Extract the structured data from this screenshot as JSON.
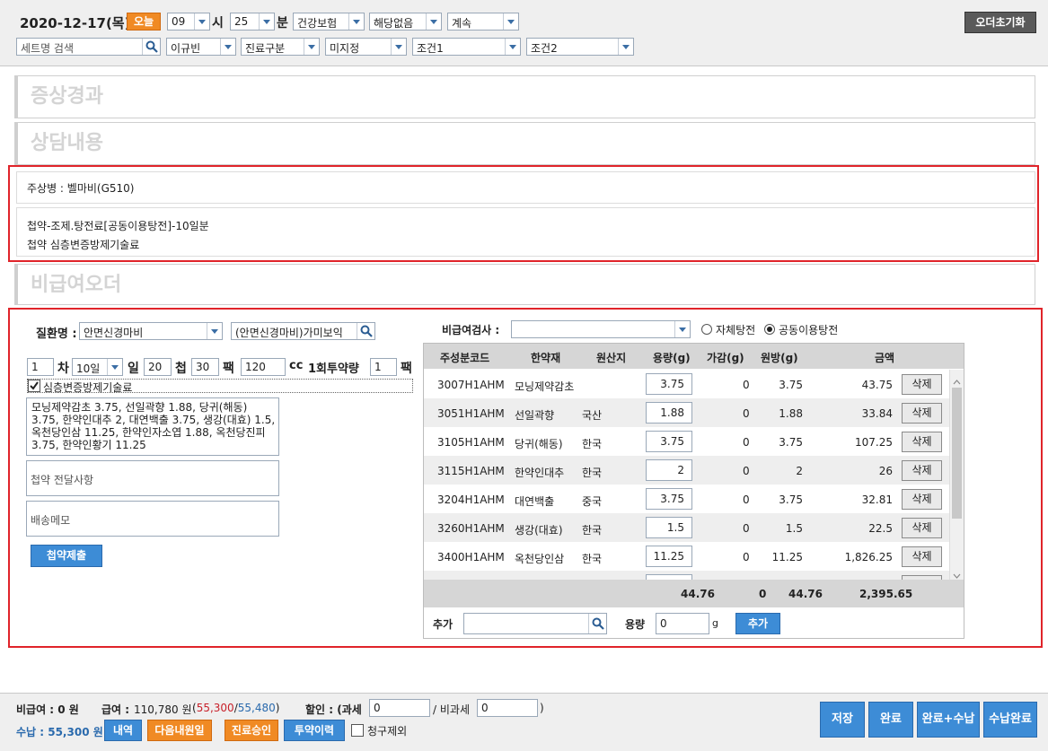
{
  "header": {
    "date": "2020-12-17(목)",
    "today_btn": "오늘",
    "hour": "09",
    "hour_unit": "시",
    "minute": "25",
    "minute_unit": "분",
    "insurance": "건강보험",
    "applicable": "해당없음",
    "continuation": "계속",
    "reset_btn": "오더초기화",
    "set_search_placeholder": "세트명 검색",
    "dept": "이규빈",
    "visit_type": "진료구분",
    "unassigned": "미지정",
    "cond1": "조건1",
    "cond2": "조건2"
  },
  "sections": {
    "symptom_title": "증상경과",
    "consult_title": "상담내용",
    "noncovered_title": "비급여오더"
  },
  "diagnosis": {
    "main_disease": "주상병 : 벨마비(G510)",
    "line1": "첩약-조제.탕전료[공동이용탕전]-10일분",
    "line2": "첩약 심층변증방제기술료"
  },
  "form": {
    "disease_label": "질환명 :",
    "disease_value": "안면신경마비",
    "prescription_value": "(안면신경마비)가미보익",
    "count_value": "1",
    "count_unit": "차",
    "days_value": "10일",
    "days_unit": "일",
    "cheop_value": "20",
    "cheop_unit": "첩",
    "pack_value": "30",
    "pack_unit": "팩",
    "cc_value": "120",
    "cc_unit": "cc",
    "dose_label": "1회투약량",
    "dose_value": "1",
    "dose_unit": "팩",
    "checkbox_label": "심층변증방제기술료",
    "herb_summary": "모닝제약감초 3.75, 선일곽향 1.88, 당귀(해동) 3.75, 한약인대추 2, 대연백출 3.75, 생강(대효) 1.5, 옥천당인삼 11.25, 한약인자소엽 1.88, 옥천당진피 3.75, 한약인황기 11.25",
    "delivery_note_placeholder": "첩약 전달사항",
    "shipping_memo_placeholder": "배송메모",
    "submit_btn": "첩약제출"
  },
  "right": {
    "test_label": "비급여검사 :",
    "radio_self": "자체탕전",
    "radio_shared": "공동이용탕전",
    "table_headers": [
      "주성분코드",
      "한약재",
      "원산지",
      "용량(g)",
      "가감(g)",
      "원방(g)",
      "금액"
    ],
    "rows": [
      {
        "code": "3007H1AHM",
        "name": "모닝제약감초",
        "origin": "",
        "qty": "3.75",
        "adj": "0",
        "orig": "3.75",
        "amount": "43.75",
        "del": "삭제"
      },
      {
        "code": "3051H1AHM",
        "name": "선일곽향",
        "origin": "국산",
        "qty": "1.88",
        "adj": "0",
        "orig": "1.88",
        "amount": "33.84",
        "del": "삭제"
      },
      {
        "code": "3105H1AHM",
        "name": "당귀(해동)",
        "origin": "한국",
        "qty": "3.75",
        "adj": "0",
        "orig": "3.75",
        "amount": "107.25",
        "del": "삭제"
      },
      {
        "code": "3115H1AHM",
        "name": "한약인대추",
        "origin": "한국",
        "qty": "2",
        "adj": "0",
        "orig": "2",
        "amount": "26",
        "del": "삭제"
      },
      {
        "code": "3204H1AHM",
        "name": "대연백출",
        "origin": "중국",
        "qty": "3.75",
        "adj": "0",
        "orig": "3.75",
        "amount": "32.81",
        "del": "삭제"
      },
      {
        "code": "3260H1AHM",
        "name": "생강(대효)",
        "origin": "한국",
        "qty": "1.5",
        "adj": "0",
        "orig": "1.5",
        "amount": "22.5",
        "del": "삭제"
      },
      {
        "code": "3400H1AHM",
        "name": "옥천당인삼",
        "origin": "한국",
        "qty": "11.25",
        "adj": "0",
        "orig": "11.25",
        "amount": "1,826.25",
        "del": "삭제"
      }
    ],
    "totals": {
      "qty": "44.76",
      "adj": "0",
      "orig": "44.76",
      "amount": "2,395.65"
    },
    "add_label": "추가",
    "qty_label": "용량",
    "add_qty_value": "0",
    "add_unit": "g",
    "add_btn": "추가"
  },
  "footer": {
    "noncovered": "비급여 : 0 원",
    "covered_label": "급여 :",
    "covered_value": "110,780 원",
    "covered_split_a": "55,300",
    "covered_split_sep": "/",
    "covered_split_b": "55,480",
    "discount_label": "할인 : (과세",
    "discount_taxed": "0",
    "discount_sep": "/ 비과세",
    "discount_untaxed": "0",
    "discount_close": ")",
    "received": "수납 : 55,300 원",
    "btn_details": "내역",
    "btn_next_visit": "다음내원일",
    "btn_approval": "진료승인",
    "btn_history": "투약이력",
    "claim_exclude": "청구제외",
    "btn_save": "저장",
    "btn_complete": "완료",
    "btn_complete_pay": "완료+수납",
    "btn_pay_complete": "수납완료"
  },
  "colors": {
    "accent_orange": "#f08a24",
    "accent_blue": "#3d8cd6",
    "highlight_red": "#e0242a"
  }
}
